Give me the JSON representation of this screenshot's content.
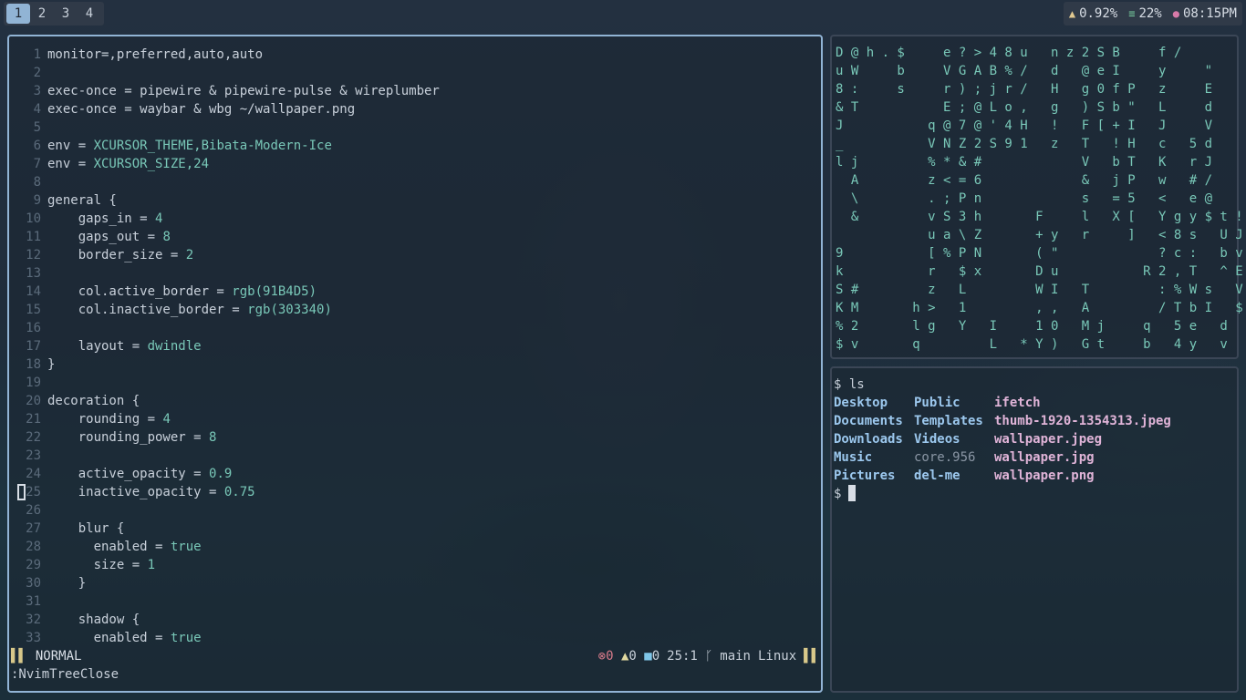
{
  "workspaces": [
    "1",
    "2",
    "3",
    "4"
  ],
  "active_workspace": "1",
  "status": {
    "cpu": "0.92%",
    "memory": "22%",
    "time": "08:15PM"
  },
  "editor": {
    "lines": [
      {
        "n": "1",
        "t": "monitor=,preferred,auto,auto"
      },
      {
        "n": "2",
        "t": ""
      },
      {
        "n": "3",
        "t": "exec-once = pipewire & pipewire-pulse & wireplumber"
      },
      {
        "n": "4",
        "t": "exec-once = waybar & wbg ~/wallpaper.png"
      },
      {
        "n": "5",
        "t": ""
      },
      {
        "n": "6",
        "t": "env = XCURSOR_THEME,Bibata-Modern-Ice"
      },
      {
        "n": "7",
        "t": "env = XCURSOR_SIZE,24"
      },
      {
        "n": "8",
        "t": ""
      },
      {
        "n": "9",
        "t": "general {"
      },
      {
        "n": "10",
        "t": "    gaps_in = 4"
      },
      {
        "n": "11",
        "t": "    gaps_out = 8"
      },
      {
        "n": "12",
        "t": "    border_size = 2"
      },
      {
        "n": "13",
        "t": ""
      },
      {
        "n": "14",
        "t": "    col.active_border = rgb(91B4D5)"
      },
      {
        "n": "15",
        "t": "    col.inactive_border = rgb(303340)"
      },
      {
        "n": "16",
        "t": ""
      },
      {
        "n": "17",
        "t": "    layout = dwindle"
      },
      {
        "n": "18",
        "t": "}"
      },
      {
        "n": "19",
        "t": ""
      },
      {
        "n": "20",
        "t": "decoration {"
      },
      {
        "n": "21",
        "t": "    rounding = 4"
      },
      {
        "n": "22",
        "t": "    rounding_power = 8"
      },
      {
        "n": "23",
        "t": ""
      },
      {
        "n": "24",
        "t": "    active_opacity = 0.9"
      },
      {
        "n": "25",
        "t": "    inactive_opacity = 0.75"
      },
      {
        "n": "26",
        "t": ""
      },
      {
        "n": "27",
        "t": "    blur {"
      },
      {
        "n": "28",
        "t": "      enabled = true"
      },
      {
        "n": "29",
        "t": "      size = 1"
      },
      {
        "n": "30",
        "t": "    }"
      },
      {
        "n": "31",
        "t": ""
      },
      {
        "n": "32",
        "t": "    shadow {"
      },
      {
        "n": "33",
        "t": "      enabled = true"
      }
    ],
    "mode": "NORMAL",
    "errors": "0",
    "warnings": "0",
    "infos": "0",
    "position": "25:1",
    "branch": "main",
    "os": "Linux",
    "cmdline": ":NvimTreeClose"
  },
  "matrix_rows": [
    "D @ h . $     e ? > 4 8 u   n z 2 S B     f /",
    "u W     b     V G A B % /   d   @ e I     y     \"",
    "8 :     s     r ) ; j r /   H   g 0 f P   z     E",
    "& T           E ; @ L o ,   g   ) S b \"   L     d",
    "J           q @ 7 @ ' 4 H   !   F [ + I   J     V",
    "_           V N Z 2 S 9 1   z   T   ! H   c   5 d",
    "l j         % * & #             V   b T   K   r J",
    "  A         z < = 6             &   j P   w   # /",
    "  \\         . ; P n             s   = 5   <   e @",
    "  &         v S 3 h       F     l   X [   Y g y $ t ! x",
    "            u a \\ Z       + y   r     ]   < 8 s   U J w",
    "9           [ % P N       ( \"             ? c :   b v !",
    "k           r   $ x       D u           R 2 , T   ^ E %",
    "S #         z   L         W I   T         : % W s   V N 0",
    "K M       h >   1         , ,   A         / T b I   $   ]",
    "% 2       l g   Y   I     1 0   M j     q   5 e   d   L",
    "$ v       q         L   * Y )   G t     b   4 y   v"
  ],
  "terminal": {
    "prompt": "$",
    "command": "ls",
    "listing": [
      [
        "Desktop",
        "Public",
        "ifetch"
      ],
      [
        "Documents",
        "Templates",
        "thumb-1920-1354313.jpeg"
      ],
      [
        "Downloads",
        "Videos",
        "wallpaper.jpeg"
      ],
      [
        "Music",
        "core.956",
        "wallpaper.jpg"
      ],
      [
        "Pictures",
        "del-me",
        "wallpaper.png"
      ]
    ]
  },
  "colors": {
    "accent": "#91B4D5",
    "inactive": "#303340"
  }
}
